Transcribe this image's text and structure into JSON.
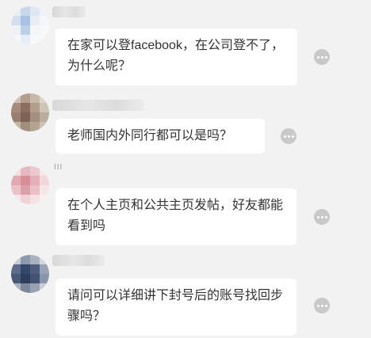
{
  "messages": [
    {
      "text": "在家可以登facebook，在公司登不了，为什么呢？"
    },
    {
      "text": "老师国内外同行都可以是吗？"
    },
    {
      "name_fragment": "III",
      "text": "在个人主页和公共主页发帖，好友都能看到吗"
    },
    {
      "text": "请问可以详细讲下封号后的账号找回步骤吗？"
    }
  ],
  "icons": {
    "more": "more-options-icon",
    "avatar": "blurred-avatar"
  },
  "colors": {
    "background": "#f2f2f2",
    "bubble": "#ffffff",
    "text": "#333333",
    "more_button": "#c9c9c9"
  }
}
